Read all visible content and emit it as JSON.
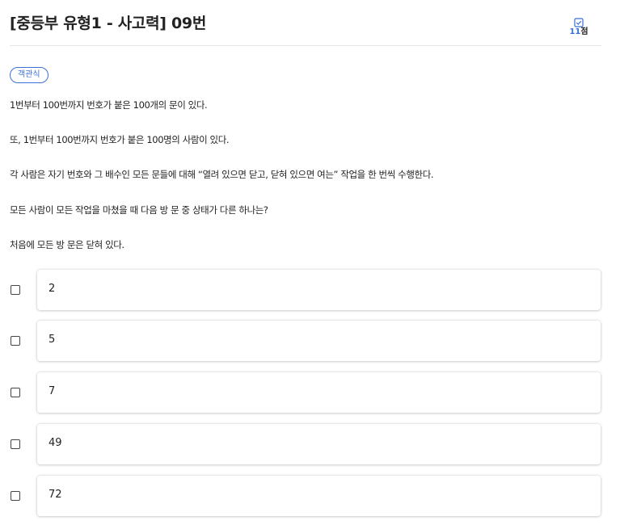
{
  "question": {
    "title": "[중등부 유형1 - 사고력] 09번",
    "score_value": "11",
    "score_unit": "점",
    "type_badge": "객관식",
    "paragraphs": [
      "1번부터 100번까지 번호가 붙은 100개의 문이 있다.",
      "또, 1번부터 100번까지 번호가 붙은 100명의 사람이 있다.",
      "각 사람은 자기 번호와 그 배수인 모든 문들에 대해 “열려 있으면 닫고, 닫혀 있으면 여는” 작업을 한 번씩 수행한다.",
      "모든 사람이 모든 작업을 마쳤을 때 다음 방 문 중 상태가 다른 하나는?",
      "처음에 모든 방 문은 닫혀 있다."
    ]
  },
  "options": [
    "2",
    "5",
    "7",
    "49",
    "72"
  ],
  "icons": {
    "score": "checkbox-icon",
    "option": "checkbox-empty-icon"
  },
  "colors": {
    "accent": "#3b6fd8",
    "text": "#222222",
    "divider": "#e6e6e6"
  }
}
